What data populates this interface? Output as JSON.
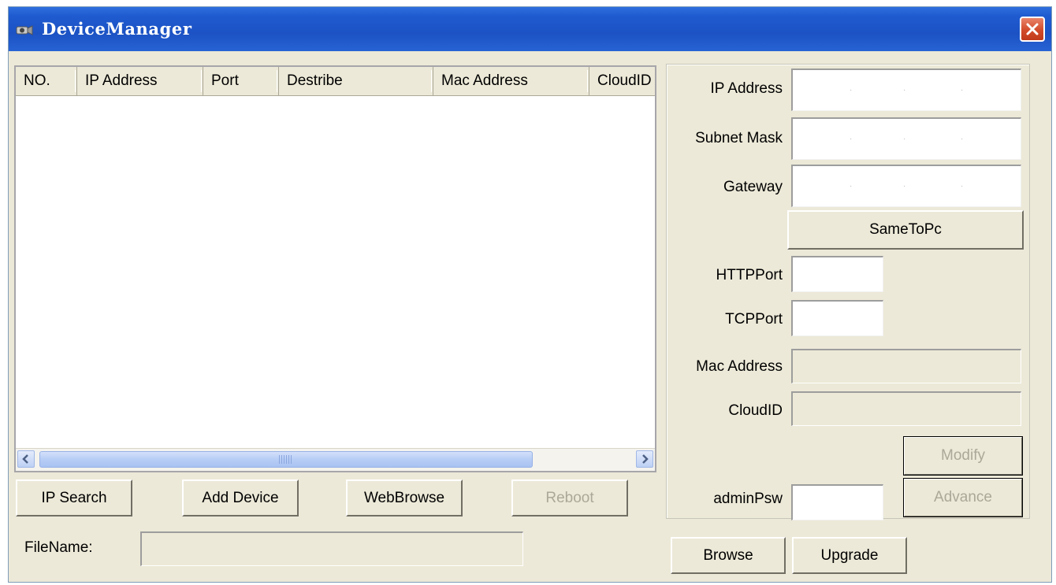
{
  "window": {
    "title": "DeviceManager",
    "icon": "camera-icon",
    "close_icon": "close-icon"
  },
  "device_list": {
    "columns": [
      "NO.",
      "IP Address",
      "Port",
      "Destribe",
      "Mac Address",
      "CloudID"
    ],
    "rows": []
  },
  "actions": {
    "ip_search": "IP Search",
    "add_device": "Add Device",
    "web_browse": "WebBrowse",
    "reboot": "Reboot"
  },
  "file": {
    "label": "FileName:",
    "value": "",
    "browse": "Browse",
    "upgrade": "Upgrade"
  },
  "settings": {
    "ip_address_label": "IP Address",
    "subnet_mask_label": "Subnet Mask",
    "gateway_label": "Gateway",
    "same_to_pc": "SameToPc",
    "http_port_label": "HTTPPort",
    "tcp_port_label": "TCPPort",
    "mac_address_label": "Mac Address",
    "cloud_id_label": "CloudID",
    "modify": "Modify",
    "admin_psw_label": "adminPsw",
    "advance": "Advance"
  },
  "colors": {
    "titlebar": "#1f5bd0",
    "dialog_bg": "#ece9d8",
    "close_button": "#d24b2a",
    "disabled_text": "#aca899"
  }
}
